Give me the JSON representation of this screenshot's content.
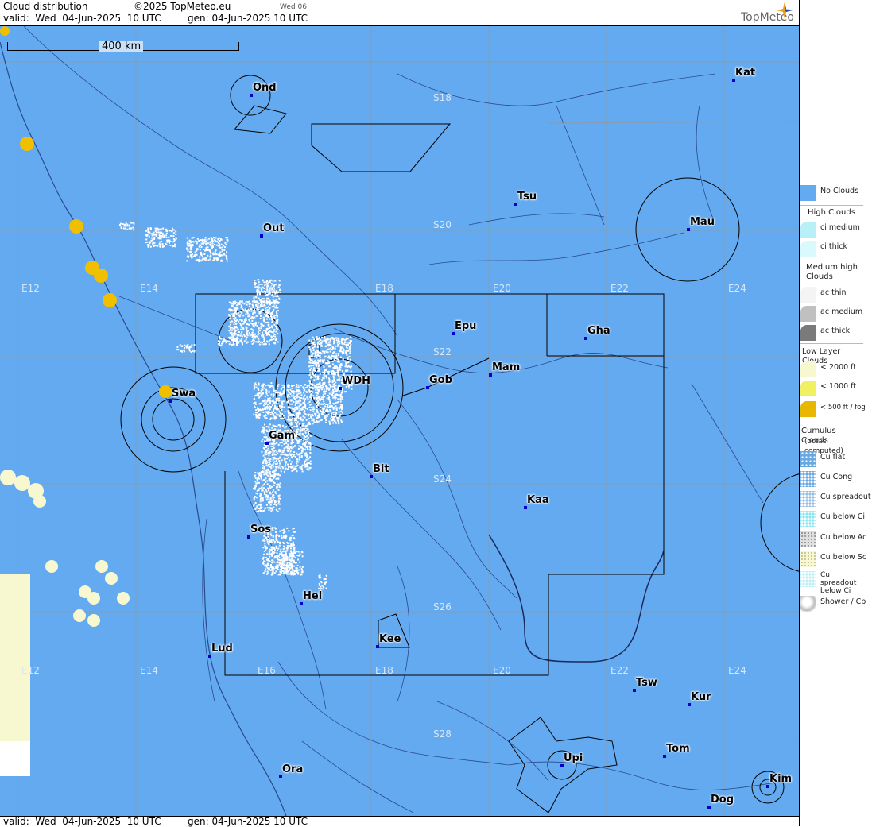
{
  "header": {
    "title": "Cloud distribution",
    "copyright": "©2025 TopMeteo.eu",
    "day_tab": "Wed 06",
    "valid": "valid:  Wed  04-Jun-2025  10 UTC",
    "gen": "gen: 04-Jun-2025 10 UTC",
    "logo": "TopMeteo"
  },
  "footer": {
    "valid": "valid:  Wed  04-Jun-2025  10 UTC",
    "gen": "gen: 04-Jun-2025 10 UTC"
  },
  "scale": {
    "label": "400 km"
  },
  "colors": {
    "no_clouds": "#64aaf0",
    "low_cloud": "#f8f8d0",
    "fog": "#f0c000",
    "cumulus": "#ffffff",
    "airspace": "#000000",
    "rivers": "#2a4a8c"
  },
  "places": [
    {
      "name": "Ond"
    },
    {
      "name": "Kat"
    },
    {
      "name": "Tsu"
    },
    {
      "name": "Mau"
    },
    {
      "name": "Out"
    },
    {
      "name": "Epu"
    },
    {
      "name": "Gha"
    },
    {
      "name": "Mam"
    },
    {
      "name": "WDH"
    },
    {
      "name": "Gob"
    },
    {
      "name": "Swa"
    },
    {
      "name": "Gam"
    },
    {
      "name": "Bit"
    },
    {
      "name": "Kaa"
    },
    {
      "name": "Sos"
    },
    {
      "name": "Hel"
    },
    {
      "name": "Lud"
    },
    {
      "name": "Kee"
    },
    {
      "name": "Tsw"
    },
    {
      "name": "Kur"
    },
    {
      "name": "Tom"
    },
    {
      "name": "Upi"
    },
    {
      "name": "Ora"
    },
    {
      "name": "Kim"
    },
    {
      "name": "Dog"
    }
  ],
  "grid_labels": {
    "lon": [
      "E12",
      "E14",
      "E16",
      "E18",
      "E20",
      "E22",
      "E24"
    ],
    "lat": [
      "S18",
      "S20",
      "S22",
      "S24",
      "S26",
      "S28"
    ]
  },
  "legend": {
    "no_clouds": "No Clouds",
    "high_head": "High Clouds",
    "ci_medium": "ci medium",
    "ci_thick": "ci thick",
    "medium_head": "Medium high Clouds",
    "ac_thin": "ac thin",
    "ac_medium": "ac medium",
    "ac_thick": "ac thick",
    "low_head": "Low Layer Clouds",
    "lt2000": "< 2000 ft",
    "lt1000": "< 1000 ft",
    "lt500": "< 500 ft / fog",
    "cu_head": "Cumulus Clouds",
    "cu_sub": "(octas computed)",
    "cu_flat": "Cu flat",
    "cu_cong": "Cu Cong",
    "cu_spread": "Cu spreadout",
    "cu_below_ci": "Cu below Ci",
    "cu_below_ac": "Cu below Ac",
    "cu_below_sc": "Cu below Sc",
    "cu_spread_ci": "Cu spreadout below Ci",
    "shower": "Shower / Cb"
  }
}
